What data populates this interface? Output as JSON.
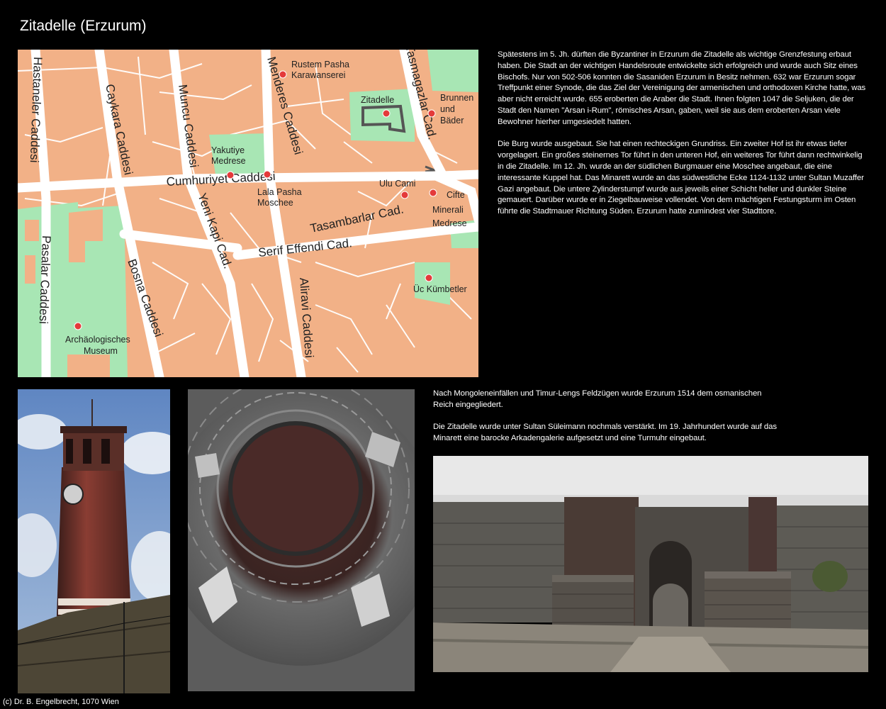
{
  "page": {
    "title": "Zitadelle (Erzurum)",
    "footer": "(c) Dr. B. Engelbrecht, 1070 Wien"
  },
  "text_top": [
    "Spätestens im 5. Jh. dürften die Byzantiner in Erzurum die Zitadelle als wichtige Grenzfestung erbaut haben. Die Stadt an der wichtigen Handelsroute entwickelte sich erfolgreich und wurde auch Sitz eines Bischofs. Nur von 502-506 konnten die Sasaniden Erzurum in Besitz nehmen. 632 war Erzurum sogar Treffpunkt einer Synode, die das Ziel der Vereinigung der armenischen und orthodoxen Kirche hatte, was aber nicht erreicht wurde. 655 eroberten die Araber die Stadt. Ihnen folgten 1047 die Seljuken, die der Stadt den Namen \"Arsan i-Rum\", römisches Arsan, gaben, weil sie aus dem eroberten Arsan viele Bewohner hierher umgesiedelt hatten.",
    "Die Burg wurde ausgebaut. Sie hat einen rechteckigen Grundriss. Ein zweiter Hof ist ihr etwas tiefer vorgelagert. Ein großes steinernes Tor führt in den unteren Hof, ein weiteres Tor führt dann rechtwinkelig in die Zitadelle. Im 12. Jh. wurde an der südlichen Burgmauer eine Moschee angebaut, die eine interessante Kuppel hat. Das Minarett wurde an das südwestliche Ecke 1124-1132 unter Sultan Muzaffer Gazi angebaut. Die untere Zylinderstumpf wurde aus jeweils einer Schicht heller und dunkler Steine gemauert. Darüber wurde er in Ziegelbauweise vollendet. Von dem mächtigen Festungsturm im Osten führte die Stadtmauer Richtung Süden. Erzurum hatte zumindest vier Stadttore."
  ],
  "text_mid": [
    "Nach Mongoleneinfällen und Timur-Lengs Feldzügen wurde Erzurum 1514 dem osmanischen Reich eingegliedert.",
    "Die Zitadelle wurde unter Sultan Süleimann nochmals verstärkt. Im 19. Jahrhundert wurde auf das Minarett eine barocke Arkadengalerie aufgesetzt und eine Turmuhr eingebaut."
  ],
  "map": {
    "streets": {
      "hastaneler": "Hastaneler Caddesi",
      "caykara": "Caykara Caddesi",
      "muncu": "Muncu Caddesi",
      "menderes": "Menderes Caddesi",
      "tasmagazlar": "Tasmagazlar Cad.",
      "cumhuriyet": "Cumhuriyet Caddesi",
      "yenikapi": "Yeni Kapi Cad.",
      "tasambarlar": "Tasambarlar Cad.",
      "serif": "Serif Effendi Cad.",
      "pasalar": "Pasalar Caddesi",
      "bosna": "Bosna Caddesi",
      "aliravi": "Aliravi Caddesi"
    },
    "pois": {
      "rustem_1": "Rustem Pasha",
      "rustem_2": "Karawanserei",
      "zitadelle": "Zitadelle",
      "brunnen_1": "Brunnen",
      "brunnen_2": "und",
      "brunnen_3": "Bäder",
      "yakutiye_1": "Yakutiye",
      "yakutiye_2": "Medrese",
      "lala_1": "Lala Pasha",
      "lala_2": "Moschee",
      "ulu": "Ulu Cami",
      "cifte_1": "Cifte",
      "cifte_2": "Minerali",
      "cifte_3": "Medrese",
      "ucKumbetler": "Üc Kümbetler",
      "museum_1": "Archäologisches",
      "museum_2": "Museum"
    },
    "colors": {
      "block": "#f2b187",
      "street": "#ffffff",
      "park": "#a8e6b4",
      "poi": "#e43a3a"
    }
  },
  "photos": {
    "minaret": "minaret-photo",
    "dome": "dome-photo",
    "gate": "gate-photo"
  }
}
